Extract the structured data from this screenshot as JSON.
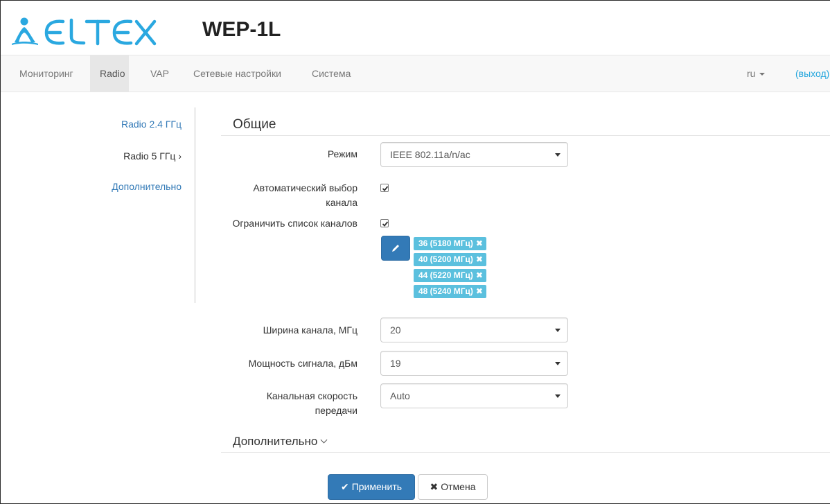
{
  "header": {
    "brand": "ELTEX",
    "device_title": "WEP-1L"
  },
  "nav": {
    "items": [
      {
        "label": "Мониторинг"
      },
      {
        "label": "Radio"
      },
      {
        "label": "VAP"
      },
      {
        "label": "Сетевые настройки"
      },
      {
        "label": "Система"
      }
    ],
    "active": "Radio",
    "language": "ru",
    "logout": "(выход)"
  },
  "sidebar": {
    "items": [
      {
        "label": "Radio 2.4 ГГц"
      },
      {
        "label": "Radio 5 ГГц ›"
      },
      {
        "label": "Дополнительно"
      }
    ]
  },
  "form": {
    "section_title": "Общие",
    "mode": {
      "label": "Режим",
      "value": "IEEE 802.11a/n/ac"
    },
    "auto_channel": {
      "label_line1": "Автоматический выбор",
      "label_line2": "канала",
      "checked": true
    },
    "limit_channels": {
      "label": "Ограничить список каналов",
      "checked": true
    },
    "channels": [
      {
        "label": "36 (5180 МГц)"
      },
      {
        "label": "40 (5200 МГц)"
      },
      {
        "label": "44 (5220 МГц)"
      },
      {
        "label": "48 (5240 МГц)"
      }
    ],
    "channel_width": {
      "label": "Ширина канала, МГц",
      "value": "20"
    },
    "tx_power": {
      "label": "Мощность сигнала, дБм",
      "value": "19"
    },
    "rate": {
      "label_line1": "Канальная скорость",
      "label_line2": "передачи",
      "value": "Auto"
    },
    "advanced_toggle": "Дополнительно",
    "apply_label": "Применить",
    "cancel_label": "Отмена"
  },
  "colors": {
    "brand_blue": "#2aa8e0",
    "primary": "#337ab7",
    "tag": "#5bc0de",
    "link": "#337ab7"
  },
  "icons": {
    "logo": "eltex-logo-icon",
    "edit": "pencil-icon",
    "apply": "check-icon",
    "cancel": "times-icon",
    "tag_remove": "times-icon"
  }
}
